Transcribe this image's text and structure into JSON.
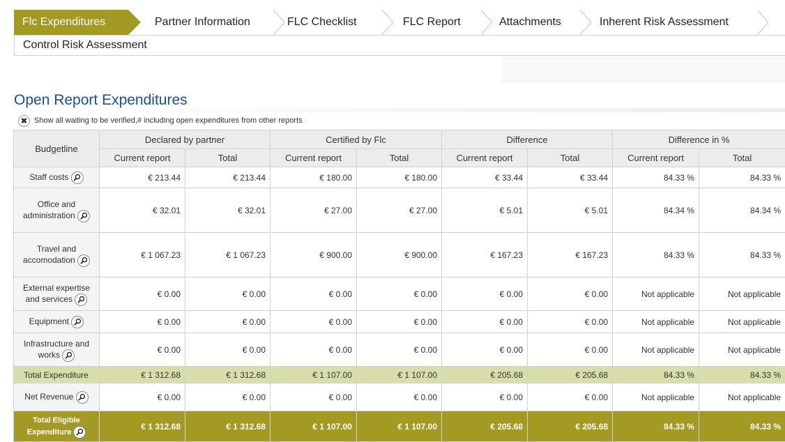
{
  "tabs": [
    {
      "label": "Flc Expenditures",
      "active": true
    },
    {
      "label": "Partner Information",
      "active": false
    },
    {
      "label": "FLC Checklist",
      "active": false
    },
    {
      "label": "FLC Report",
      "active": false
    },
    {
      "label": "Attachments",
      "active": false
    },
    {
      "label": "Inherent Risk Assessment",
      "active": false
    }
  ],
  "tabs_row2": [
    {
      "label": "Control Risk Assessment"
    }
  ],
  "heading": "Open Report Expenditures",
  "toggle_label": "Show all waiting to be verified,# including open expenditures from other reports",
  "table": {
    "budgetline_header": "Budgetline",
    "groups": [
      "Declared by partner",
      "Certified by Flc",
      "Difference",
      "Difference in %"
    ],
    "subheaders": [
      "Current report",
      "Total",
      "Current report",
      "Total",
      "Current report",
      "Total",
      "Current report",
      "Total"
    ],
    "rows": [
      {
        "label": "Staff costs",
        "values": [
          "€ 213.44",
          "€ 213.44",
          "€ 180.00",
          "€ 180.00",
          "€ 33.44",
          "€ 33.44",
          "84.33 %",
          "84.33 %"
        ]
      },
      {
        "label": "Office and administration",
        "values": [
          "€ 32.01",
          "€ 32.01",
          "€ 27.00",
          "€ 27.00",
          "€ 5.01",
          "€ 5.01",
          "84.34 %",
          "84.34 %"
        ]
      },
      {
        "label": "Travel and accomodation",
        "values": [
          "€ 1 067.23",
          "€ 1 067.23",
          "€ 900.00",
          "€ 900.00",
          "€ 167.23",
          "€ 167.23",
          "84.33 %",
          "84.33 %"
        ]
      },
      {
        "label": "External expertise and services",
        "values": [
          "€ 0.00",
          "€ 0.00",
          "€ 0.00",
          "€ 0.00",
          "€ 0.00",
          "€ 0.00",
          "Not applicable",
          "Not applicable"
        ]
      },
      {
        "label": "Equipment",
        "values": [
          "€ 0.00",
          "€ 0.00",
          "€ 0.00",
          "€ 0.00",
          "€ 0.00",
          "€ 0.00",
          "Not applicable",
          "Not applicable"
        ]
      },
      {
        "label": "Infrastructure and works",
        "values": [
          "€ 0.00",
          "€ 0.00",
          "€ 0.00",
          "€ 0.00",
          "€ 0.00",
          "€ 0.00",
          "Not applicable",
          "Not applicable"
        ]
      }
    ],
    "total": {
      "label": "Total Expenditure",
      "values": [
        "€ 1 312.68",
        "€ 1 312.68",
        "€ 1 107.00",
        "€ 1 107.00",
        "€ 205.68",
        "€ 205.68",
        "84.33 %",
        "84.33 %"
      ]
    },
    "net_revenue": {
      "label": "Net Revenue",
      "values": [
        "€ 0.00",
        "€ 0.00",
        "€ 0.00",
        "€ 0.00",
        "€ 0.00",
        "€ 0.00",
        "Not applicable",
        "Not applicable"
      ]
    },
    "eligible": {
      "label": "Total Eligible Expenditure",
      "values": [
        "€ 1 312.68",
        "€ 1 312.68",
        "€ 1 107.00",
        "€ 1 107.00",
        "€ 205.68",
        "€ 205.68",
        "84.33 %",
        "84.33 %"
      ]
    }
  },
  "colors": {
    "accent": "#a39a23",
    "total_row": "#d8dea9",
    "heading": "#1c4f99"
  },
  "icons": {
    "row_action": "magnifier-icon",
    "toggle": "close-icon"
  }
}
